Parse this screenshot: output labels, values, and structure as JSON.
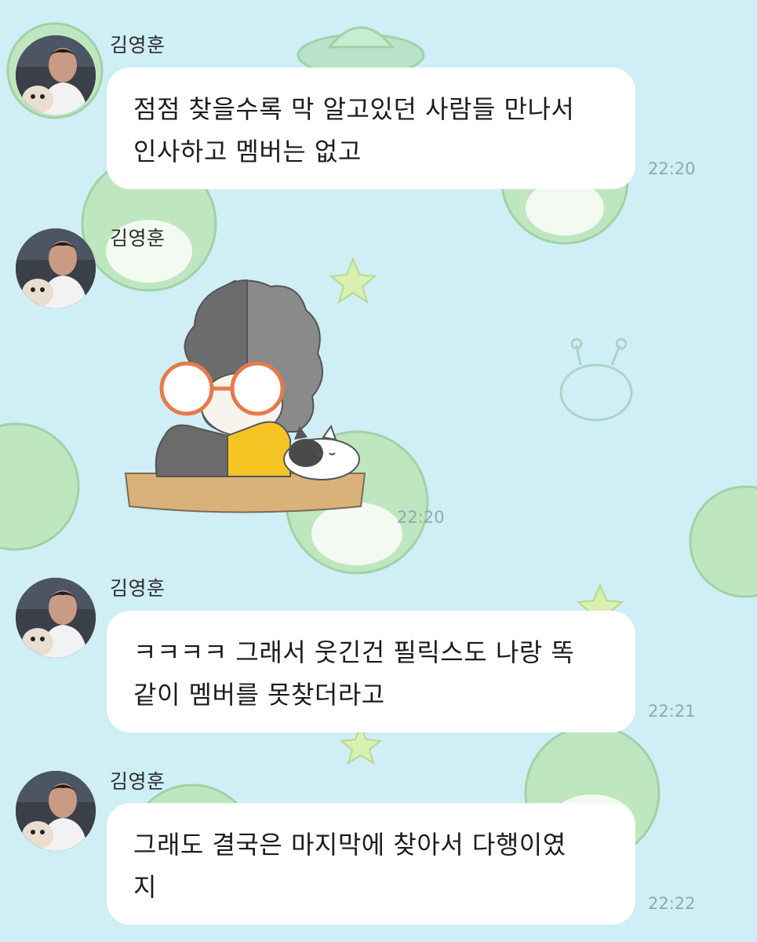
{
  "chat": {
    "messages": [
      {
        "sender": "김영훈",
        "type": "text",
        "text_line1": "점점 찾을수록 막 알고있던 사람들 만나서",
        "text_line2": "인사하고 멤버는 없고",
        "time": "22:20"
      },
      {
        "sender": "김영훈",
        "type": "sticker",
        "sticker_icon": "afro-glasses-character-with-cat-sticker",
        "time": "22:20"
      },
      {
        "sender": "김영훈",
        "type": "text",
        "text_line1": "ㅋㅋㅋㅋ 그래서 웃긴건 필릭스도 나랑 똑",
        "text_line2": "같이 멤버를 못찾더라고",
        "time": "22:21"
      },
      {
        "sender": "김영훈",
        "type": "text",
        "text_line1": "그래도 결국은 마지막에 찾아서 다행이였",
        "text_line2": "지",
        "time": "22:22"
      }
    ]
  },
  "theme": {
    "background": "#cfeef6",
    "bubble": "#ffffff",
    "timestamp": "#93a6ad"
  }
}
